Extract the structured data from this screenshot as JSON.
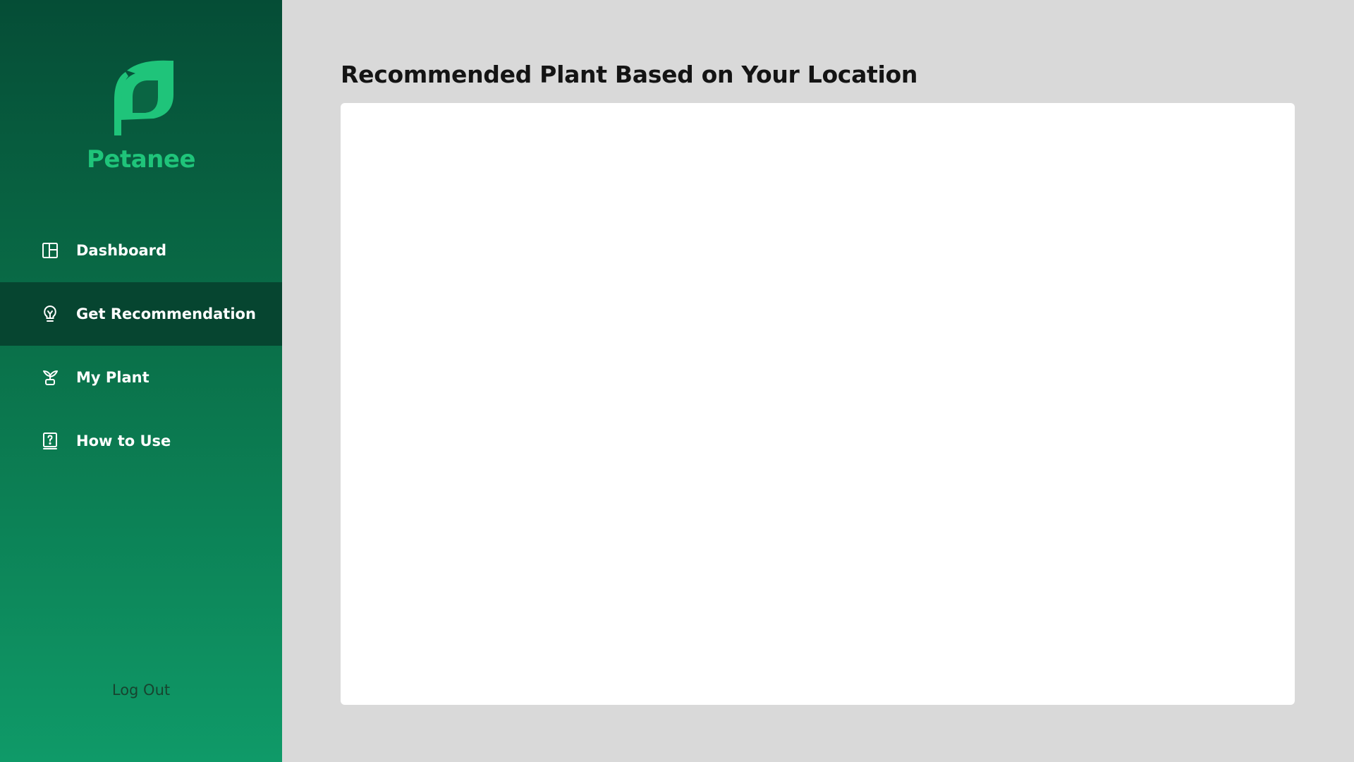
{
  "brand": {
    "name": "Petanee",
    "logo_icon": "leaf-logo-icon",
    "color": "#1fc47a"
  },
  "sidebar": {
    "items": [
      {
        "label": "Dashboard",
        "icon": "dashboard-layout-icon",
        "active": false
      },
      {
        "label": "Get Recommendation",
        "icon": "lightbulb-icon",
        "active": true
      },
      {
        "label": "My Plant",
        "icon": "sprout-pot-icon",
        "active": false
      },
      {
        "label": "How to Use",
        "icon": "help-book-icon",
        "active": false
      }
    ],
    "logout_label": "Log Out"
  },
  "main": {
    "title": "Recommended Plant Based on Your Location"
  },
  "colors": {
    "sidebar_top": "#054d36",
    "sidebar_bottom": "#0f9a68",
    "active_item": "#064530",
    "background": "#d9d9d9",
    "card": "#ffffff"
  }
}
